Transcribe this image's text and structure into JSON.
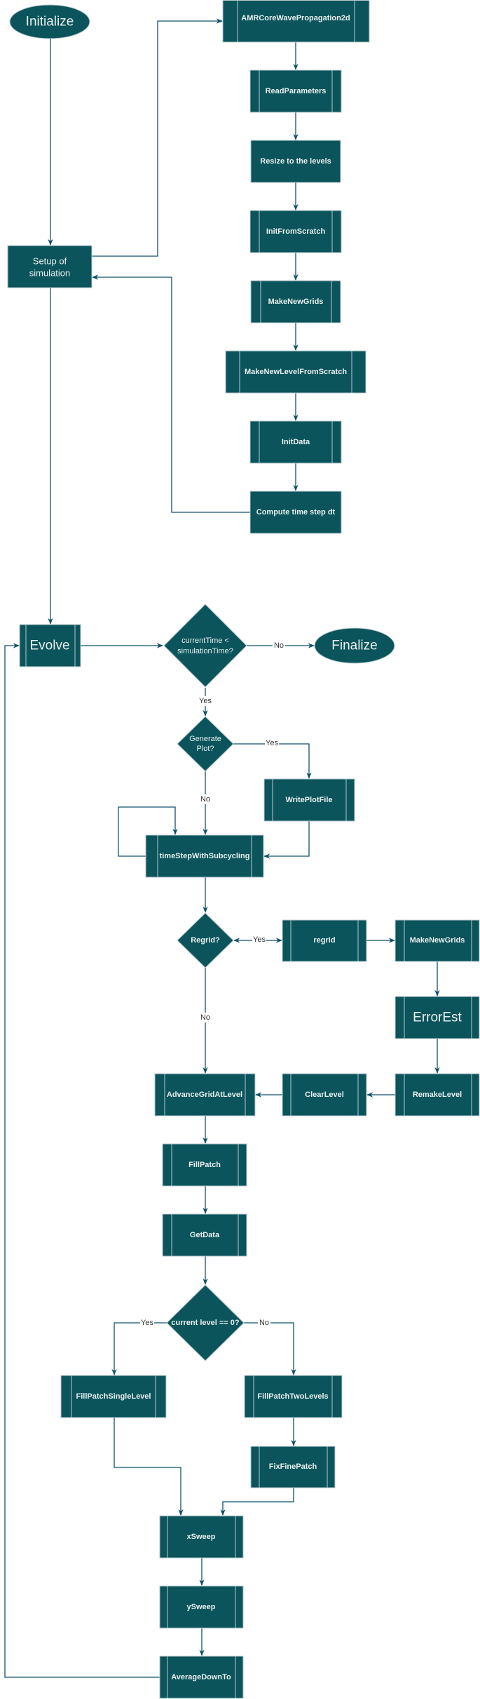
{
  "colors": {
    "node_fill": "#0b545b",
    "node_border": "#b9c9cf",
    "edge": "#10506b",
    "node_text": "#e8eff1"
  },
  "nodes": {
    "initialize": "Initialize",
    "amr_core": "AMRCoreWavePropagation2d",
    "read_parameters": "ReadParameters",
    "resize": "Resize to the levels",
    "init_from_scratch": "InitFromScratch",
    "make_new_grids": "MakeNewGrids",
    "make_new_level": "MakeNewLevelFromScratch",
    "init_data": "InitData",
    "compute_dt": "Compute time step dt",
    "setup_line1": "Setup of",
    "setup_line2": "simulation",
    "evolve": "Evolve",
    "time_check_line1": "currentTime <",
    "time_check_line2": "simulationTime?",
    "finalize": "Finalize",
    "gen_plot_line1": "Generate",
    "gen_plot_line2": "Plot?",
    "write_plot_file": "WritePlotFile",
    "time_step": "timeStepWithSubcycling",
    "regrid_q": "Regrid?",
    "regrid": "regrid",
    "make_new_grids_2": "MakeNewGrids",
    "error_est": "ErrorEst",
    "remake_level": "RemakeLevel",
    "clear_level": "ClearLevel",
    "advance": "AdvanceGridAtLevel",
    "fill_patch": "FillPatch",
    "get_data": "GetData",
    "level_check": "current level == 0?",
    "fp_single": "FillPatchSingleLevel",
    "fp_two": "FillPatchTwoLevels",
    "fix_fine": "FixFinePatch",
    "x_sweep": "xSweep",
    "y_sweep": "ySweep",
    "average_down": "AverageDownTo"
  },
  "edge_labels": {
    "yes": "Yes",
    "no": "No"
  }
}
